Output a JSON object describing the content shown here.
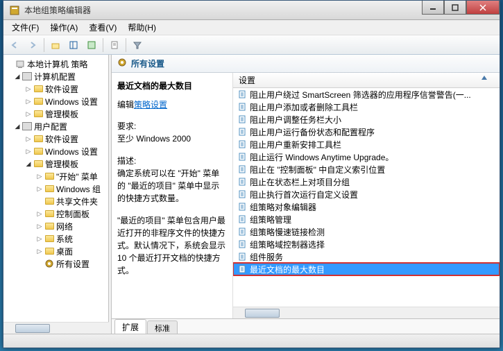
{
  "window": {
    "title": "本地组策略编辑器"
  },
  "menu": {
    "file": "文件(F)",
    "action": "操作(A)",
    "view": "查看(V)",
    "help": "帮助(H)"
  },
  "tree": {
    "root": "本地计算机 策略",
    "computer": "计算机配置",
    "user": "用户配置",
    "soft": "软件设置",
    "win": "Windows 设置",
    "admin": "管理模板",
    "start_menu": "\"开始\" 菜单",
    "win_components": "Windows 组",
    "shared": "共享文件夹",
    "control_panel": "控制面板",
    "network": "网络",
    "system": "系统",
    "desktop": "桌面",
    "all_settings": "所有设置"
  },
  "right": {
    "header": "所有设置",
    "desc_title": "最近文档的最大数目",
    "edit_prefix": "编辑",
    "edit_link": "策略设置",
    "req_label": "要求:",
    "req_value": "至少 Windows 2000",
    "desc_label": "描述:",
    "desc_p1": "确定系统可以在 \"开始\" 菜单的 \"最近的项目\" 菜单中显示的快捷方式数量。",
    "desc_p2": "\"最近的项目\" 菜单包含用户最近打开的非程序文件的快捷方式。默认情况下，系统会显示 10 个最近打开文档的快捷方式。",
    "list_col": "设置",
    "items": [
      "阻止用户绕过 SmartScreen 筛选器的应用程序信誉警告(一...",
      "阻止用户添加或者删除工具栏",
      "阻止用户调整任务栏大小",
      "阻止用户运行备份状态和配置程序",
      "阻止用户重新安排工具栏",
      "阻止运行 Windows Anytime Upgrade。",
      "阻止在 \"控制面板\" 中自定义索引位置",
      "阻止在状态栏上对项目分组",
      "阻止执行首次运行自定义设置",
      "组策略对象编辑器",
      "组策略管理",
      "组策略慢速链接检测",
      "组策略域控制器选择",
      "组件服务",
      "最近文档的最大数目"
    ],
    "selected_index": 14
  },
  "tabs": {
    "extended": "扩展",
    "standard": "标准"
  }
}
